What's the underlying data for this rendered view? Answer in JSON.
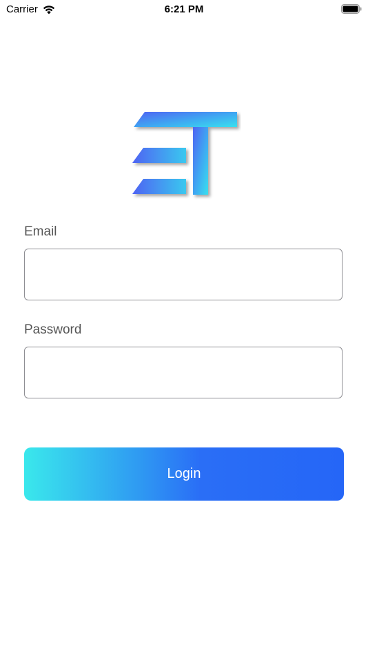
{
  "status_bar": {
    "carrier": "Carrier",
    "time": "6:21 PM",
    "wifi_icon": "wifi-icon",
    "battery_icon": "battery-full-icon"
  },
  "logo": {
    "name": "et-logo",
    "colors": {
      "gradient_start": "#3ae8ec",
      "gradient_end": "#3f64f5"
    }
  },
  "form": {
    "email_label": "Email",
    "email_value": "",
    "email_placeholder": "",
    "password_label": "Password",
    "password_value": "",
    "password_placeholder": "",
    "login_label": "Login"
  },
  "colors": {
    "button_gradient_start": "#3ae8ec",
    "button_gradient_end": "#2566f7",
    "label_text": "#555555",
    "field_border": "#8e8e93"
  }
}
